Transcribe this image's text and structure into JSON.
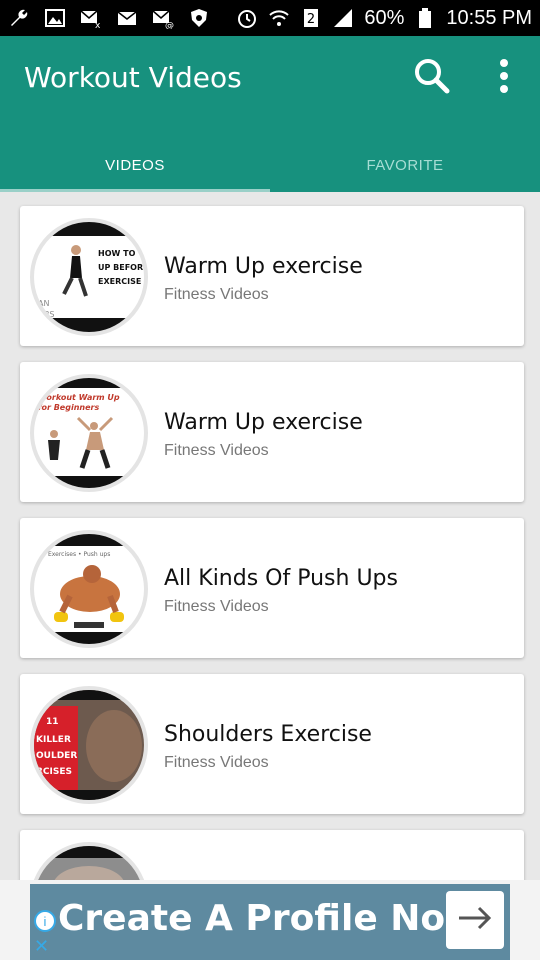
{
  "statusbar": {
    "battery": "60%",
    "time": "10:55 PM",
    "sim_number": "2"
  },
  "appbar": {
    "title": "Workout Videos"
  },
  "tabs": [
    {
      "label": "VIDEOS",
      "active": true
    },
    {
      "label": "FAVORITE",
      "active": false
    }
  ],
  "videos": [
    {
      "title": "Warm Up exercise",
      "subtitle": "Fitness Videos"
    },
    {
      "title": "Warm Up exercise",
      "subtitle": "Fitness Videos"
    },
    {
      "title": "All Kinds Of Push Ups",
      "subtitle": "Fitness Videos"
    },
    {
      "title": "Shoulders Exercise",
      "subtitle": "Fitness Videos"
    },
    {
      "title": "",
      "subtitle": ""
    }
  ],
  "thumbs": {
    "t1": {
      "line1": "HOW TO V",
      "line2": "UP BEFORI",
      "line3": "EXERCISE",
      "corner": "AN",
      "corner2": "NBS"
    },
    "t2": {
      "line1": "Workout Warm Up",
      "line2": "for Beginners"
    },
    "t3": {
      "caption": "Exercises • Push ups"
    },
    "t4": {
      "line1": "11",
      "line2": "KILLER",
      "line3": "OULDER",
      "line4": "RCISES"
    }
  },
  "ad": {
    "text": "Create A Profile Now"
  },
  "colors": {
    "primary": "#17917e",
    "card": "#ffffff",
    "background": "#e8e8e8",
    "ad": "#5e8aa0"
  }
}
